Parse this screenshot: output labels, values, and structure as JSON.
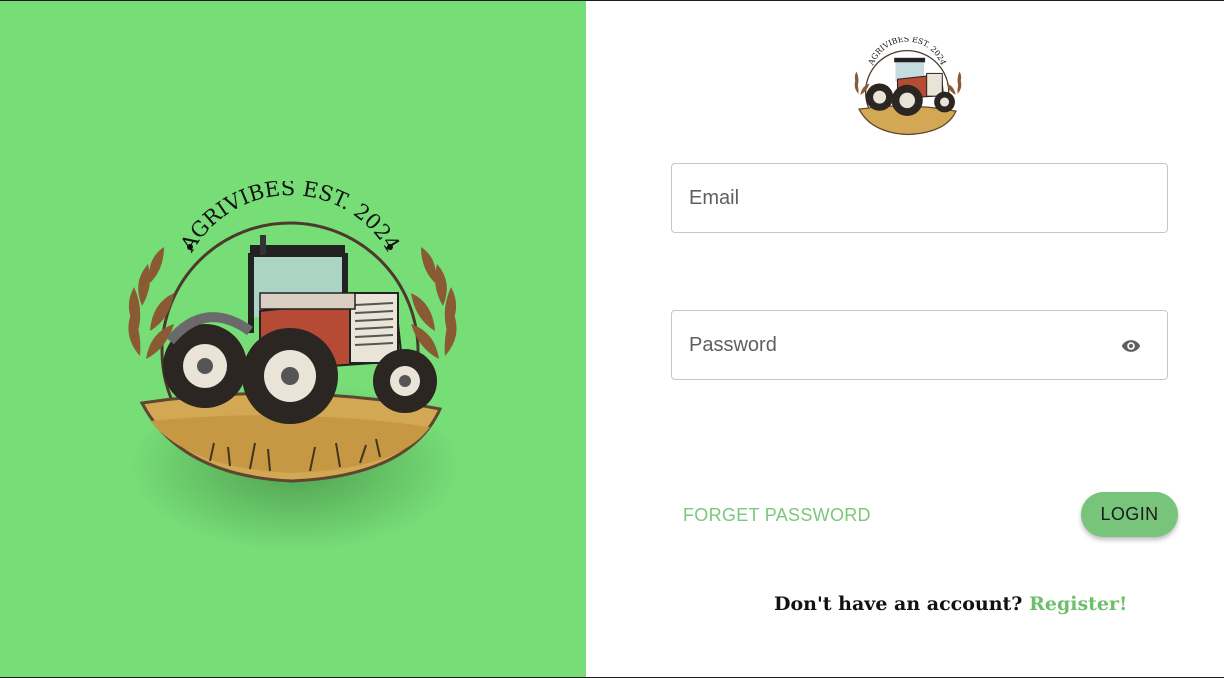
{
  "brand": {
    "logo_text": "AGRIVIBES EST. 2024"
  },
  "login_form": {
    "email_placeholder": "Email",
    "password_placeholder": "Password",
    "password_toggle_icon": "eye-icon",
    "forget_password_label": "FORGET PASSWORD",
    "login_label": "LOGIN",
    "register_prompt": "Don't have an account?",
    "register_link": "Register!"
  },
  "colors": {
    "left_panel_bg": "#77dd77",
    "accent_green": "#77c47a",
    "link_green": "#6cc06c"
  }
}
